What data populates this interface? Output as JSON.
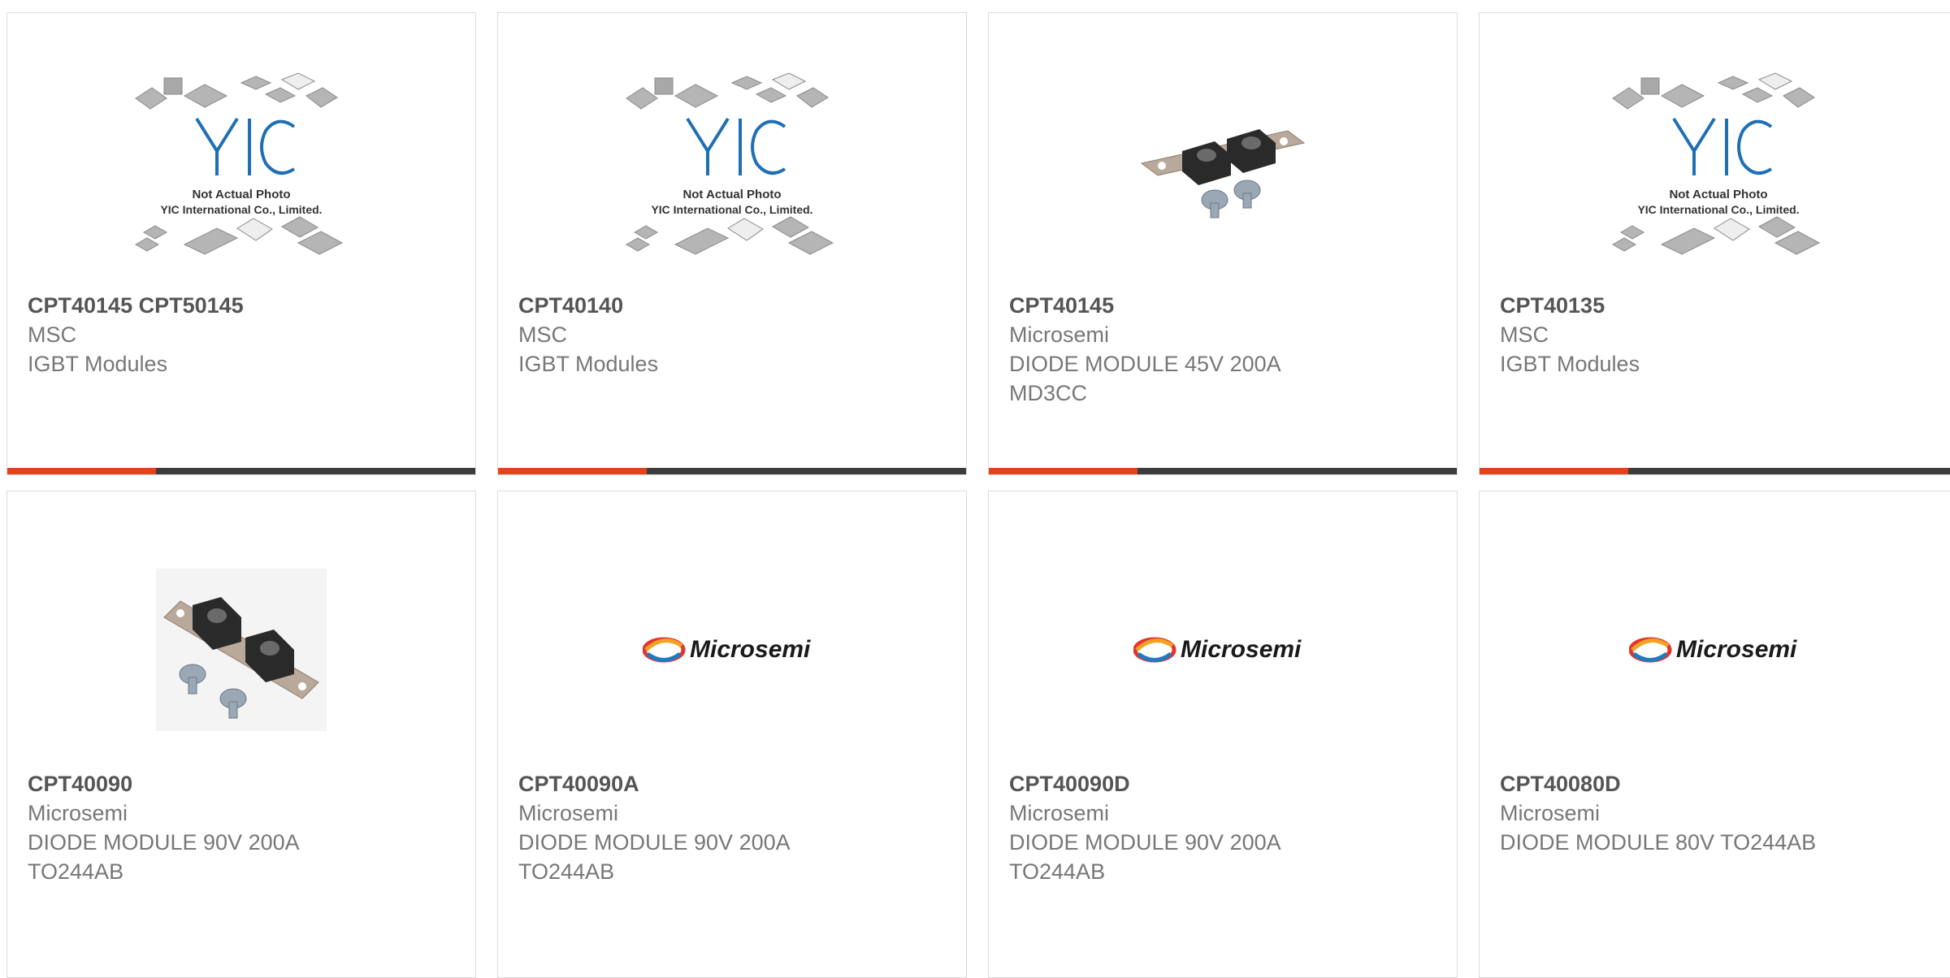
{
  "products": [
    {
      "part": "CPT40145 CPT50145",
      "maker": "MSC",
      "desc": [
        "IGBT Modules"
      ],
      "image": "yic-placeholder"
    },
    {
      "part": "CPT40140",
      "maker": "MSC",
      "desc": [
        "IGBT Modules"
      ],
      "image": "yic-placeholder"
    },
    {
      "part": "CPT40145",
      "maker": "Microsemi",
      "desc": [
        "DIODE MODULE 45V 200A",
        "MD3CC"
      ],
      "image": "diode-module-photo"
    },
    {
      "part": "CPT40135",
      "maker": "MSC",
      "desc": [
        "IGBT Modules"
      ],
      "image": "yic-placeholder"
    },
    {
      "part": "CPT40090",
      "maker": "Microsemi",
      "desc": [
        "DIODE MODULE 90V 200A",
        "TO244AB"
      ],
      "image": "diode-module-photo"
    },
    {
      "part": "CPT40090A",
      "maker": "Microsemi",
      "desc": [
        "DIODE MODULE 90V 200A",
        "TO244AB"
      ],
      "image": "microsemi-logo"
    },
    {
      "part": "CPT40090D",
      "maker": "Microsemi",
      "desc": [
        "DIODE MODULE 90V 200A",
        "TO244AB"
      ],
      "image": "microsemi-logo"
    },
    {
      "part": "CPT40080D",
      "maker": "Microsemi",
      "desc": [
        "DIODE MODULE 80V TO244AB"
      ],
      "image": "microsemi-logo"
    }
  ],
  "placeholder": {
    "logo_text": "YIC",
    "line1": "Not Actual Photo",
    "line2": "YIC International Co., Limited."
  },
  "brand_logo_text": "Microsemi",
  "colors": {
    "accent": "#e2431c",
    "bar": "#3c3c3c",
    "yic_blue": "#1f6fb5"
  }
}
